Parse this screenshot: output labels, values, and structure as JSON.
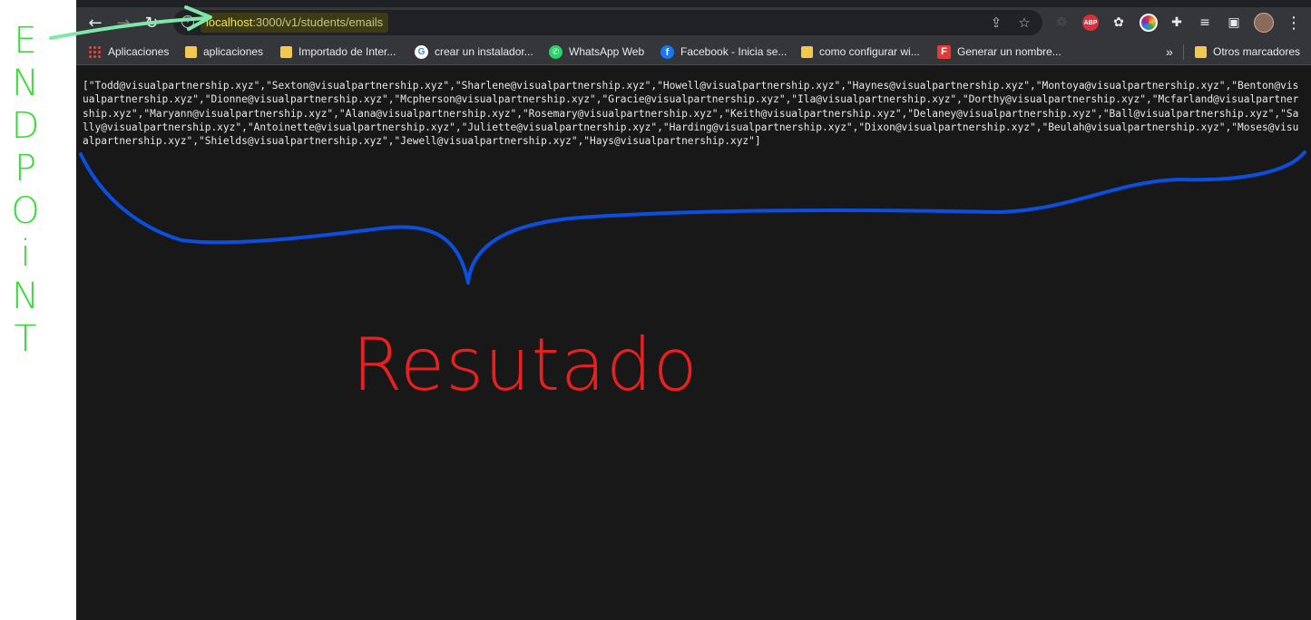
{
  "browser": {
    "toolbar": {
      "back_icon": "←",
      "forward_icon": "→",
      "reload_icon": "↻",
      "url_host": "localhost",
      "url_rest": ":3000/v1/students/emails",
      "share_icon": "⇪",
      "star_icon": "☆",
      "extensions": [
        "recycle-icon",
        "adblock-icon",
        "openai-icon",
        "color-picker-icon",
        "puzzle-icon",
        "media-icon",
        "sidepanel-icon",
        "profile-avatar",
        "menu-icon"
      ],
      "abp_label": "ABP",
      "puzzle_glyph": "✚",
      "media_glyph": "≡",
      "sidepanel_glyph": "▣",
      "menu_glyph": "⋮"
    },
    "bookmarks": {
      "items": [
        {
          "label": "Aplicaciones",
          "icon": "apps-grid-icon"
        },
        {
          "label": "aplicaciones",
          "icon": "folder-icon"
        },
        {
          "label": "Importado de Inter...",
          "icon": "folder-icon"
        },
        {
          "label": "crear un instalador...",
          "icon": "google-icon"
        },
        {
          "label": "WhatsApp Web",
          "icon": "whatsapp-icon"
        },
        {
          "label": "Facebook - Inicia se...",
          "icon": "facebook-icon"
        },
        {
          "label": "como configurar wi...",
          "icon": "folder-icon"
        },
        {
          "label": "Generar un nombre...",
          "icon": "flipboard-icon"
        }
      ],
      "overflow_label": "»",
      "other_label": "Otros marcadores"
    }
  },
  "content": {
    "json_response": "[\"Todd@visualpartnership.xyz\",\"Sexton@visualpartnership.xyz\",\"Sharlene@visualpartnership.xyz\",\"Howell@visualpartnership.xyz\",\"Haynes@visualpartnership.xyz\",\"Montoya@visualpartnership.xyz\",\"Benton@visualpartnership.xyz\",\"Dionne@visualpartnership.xyz\",\"Mcpherson@visualpartnership.xyz\",\"Gracie@visualpartnership.xyz\",\"Ila@visualpartnership.xyz\",\"Dorthy@visualpartnership.xyz\",\"Mcfarland@visualpartnership.xyz\",\"Maryann@visualpartnership.xyz\",\"Alana@visualpartnership.xyz\",\"Rosemary@visualpartnership.xyz\",\"Keith@visualpartnership.xyz\",\"Delaney@visualpartnership.xyz\",\"Ball@visualpartnership.xyz\",\"Sally@visualpartnership.xyz\",\"Antoinette@visualpartnership.xyz\",\"Juliette@visualpartnership.xyz\",\"Harding@visualpartnership.xyz\",\"Dixon@visualpartnership.xyz\",\"Beulah@visualpartnership.xyz\",\"Moses@visualpartnership.xyz\",\"Shields@visualpartnership.xyz\",\"Jewell@visualpartnership.xyz\",\"Hays@visualpartnership.xyz\"]"
  },
  "annotations": {
    "endpoint_label": "ENDPOiNT",
    "result_label": "Resutado",
    "endpoint_color": "#33dd33",
    "result_color": "#e82020",
    "brace_color": "#0a4fe0"
  }
}
